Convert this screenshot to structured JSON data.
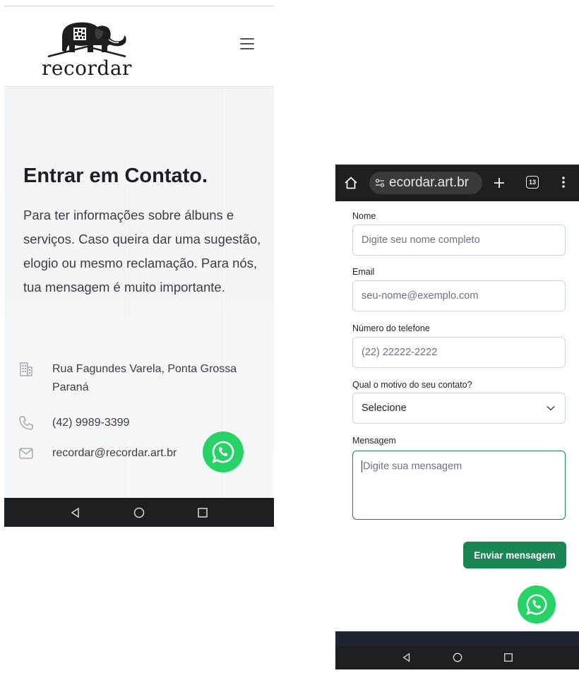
{
  "left_screen": {
    "brand": {
      "logo_text": "recordar"
    },
    "menu_icon": "hamburger-icon",
    "heading": "Entrar em Contato.",
    "description": "Para ter informações sobre álbuns e serviços. Caso queira dar uma sugestão, elogio ou mesmo reclamação. Para nós, tua mensagem é muito importante.",
    "contact": {
      "address": "Rua Fagundes Varela, Ponta Grossa Paraná",
      "phone": "(42) 9989-3399",
      "email": "recordar@recordar.art.br"
    },
    "whatsapp_icon": "whatsapp-icon",
    "android_nav": [
      "back-icon",
      "home-icon",
      "recents-icon"
    ]
  },
  "right_screen": {
    "browser": {
      "url": "ecordar.art.br",
      "tab_count": "13",
      "icons": [
        "home-icon",
        "site-settings-icon",
        "new-tab-icon",
        "tabs-icon",
        "more-icon"
      ]
    },
    "form": {
      "name": {
        "label": "Nome",
        "placeholder": "Digite seu nome completo"
      },
      "email": {
        "label": "Email",
        "placeholder": "seu-nome@exemplo.com"
      },
      "phone": {
        "label": "Número do telefone",
        "placeholder": "(22) 22222-2222"
      },
      "reason": {
        "label": "Qual o motivo do seu contato?",
        "selected": "Selecione"
      },
      "message": {
        "label": "Mensagem",
        "placeholder": "Digite sua mensagem"
      },
      "submit_label": "Enviar mensagem"
    },
    "colors": {
      "primary_green": "#198754",
      "whatsapp_green": "#25d366"
    }
  }
}
